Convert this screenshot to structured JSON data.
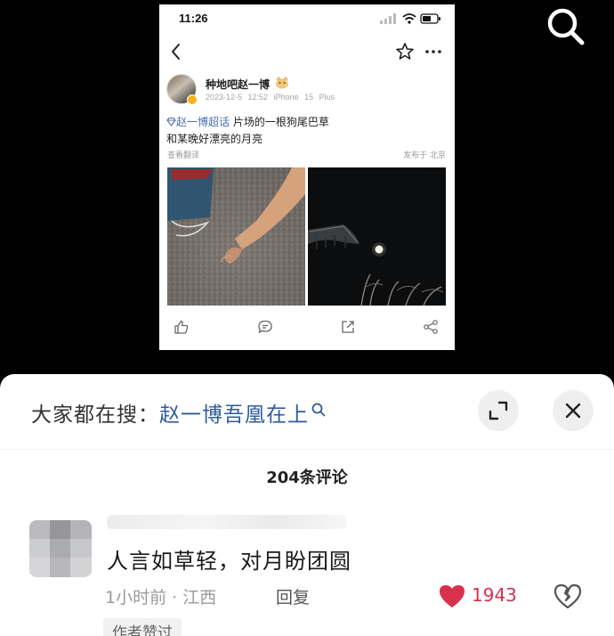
{
  "status_bar": {
    "time": "11:26"
  },
  "post": {
    "author": "种地吧赵一博",
    "date": "2023-12-5 12:52",
    "device": "iPhone 15 Plus",
    "topic": "赵一博超话",
    "text_line1": " 片场的一根狗尾巴草",
    "text_line2": "和某晚好漂亮的月亮",
    "translate_label": "查看翻译",
    "location": "发布于 北京"
  },
  "sheet": {
    "hot_search_label": "大家都在搜：",
    "hot_search_term": "赵一博吾凰在上",
    "comment_count": "204条评论",
    "comment": {
      "text": "人言如草轻，对月盼团圆",
      "time_location": "1小时前 · 江西",
      "reply_label": "回复",
      "likes": "1943",
      "author_liked_badge": "作者赞过"
    }
  },
  "colors": {
    "topic_link": "#4a6fae",
    "hot_search_term": "#2f5b9a",
    "like_red": "#d9314d"
  },
  "icons": [
    "search-icon",
    "back-icon",
    "star-icon",
    "more-icon",
    "like-icon",
    "comment-icon",
    "share-icon",
    "repost-icon",
    "expand-icon",
    "close-icon",
    "heart-icon",
    "broken-heart-icon",
    "magnifier-icon"
  ]
}
